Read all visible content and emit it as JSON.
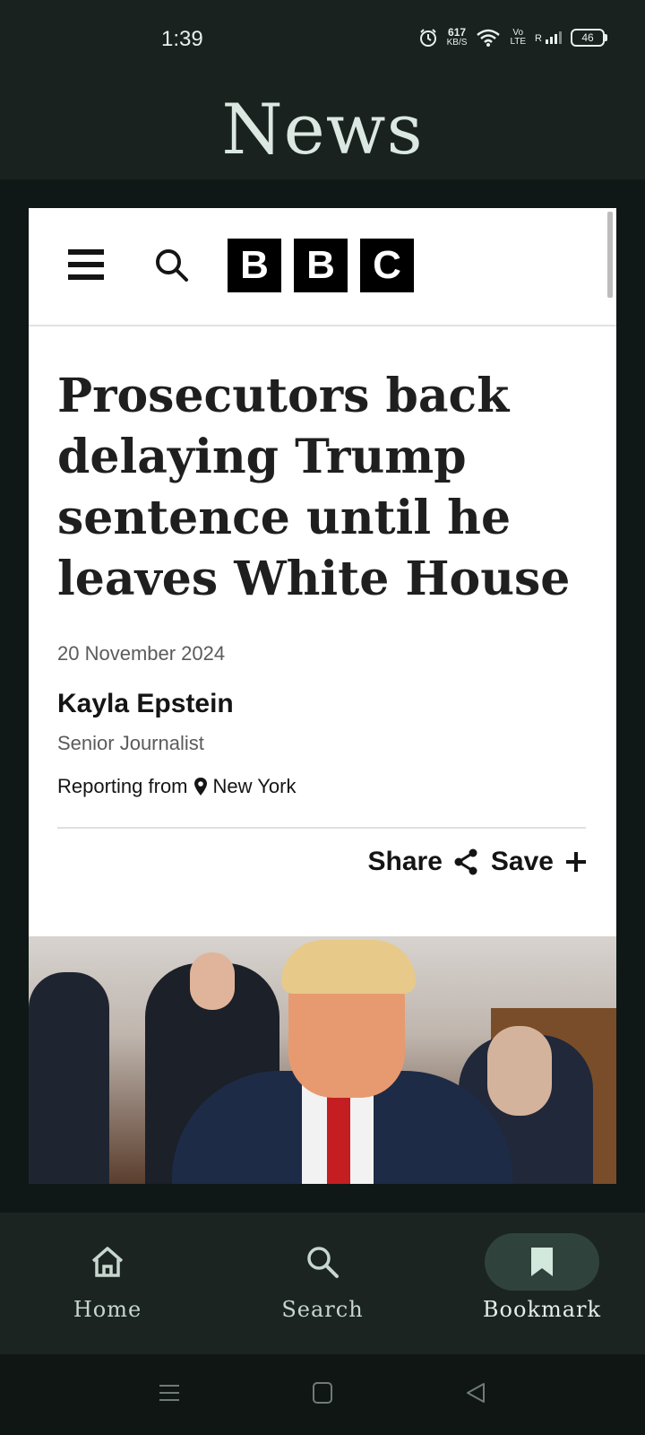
{
  "status_bar": {
    "time": "1:39",
    "speed_value": "617",
    "speed_unit": "KB/S",
    "network_top": "Vo",
    "network_bottom": "LTE",
    "roaming": "R",
    "battery": "46"
  },
  "app": {
    "title": "News"
  },
  "article": {
    "site_logo_letters": [
      "B",
      "B",
      "C"
    ],
    "headline": "Prosecutors back delaying Trump sentence until he leaves White House",
    "date": "20 November 2024",
    "author": "Kayla Epstein",
    "author_role": "Senior Journalist",
    "reporting_prefix": "Reporting from",
    "location": "New York",
    "share_label": "Share",
    "save_label": "Save"
  },
  "bottom_nav": {
    "items": [
      {
        "label": "Home",
        "icon": "home-icon",
        "active": false
      },
      {
        "label": "Search",
        "icon": "search-icon",
        "active": false
      },
      {
        "label": "Bookmark",
        "icon": "bookmark-icon",
        "active": true
      }
    ]
  },
  "colors": {
    "app_bar": "#19221f",
    "nav_active_pill": "#2f433c",
    "tie": "#c41e22"
  }
}
